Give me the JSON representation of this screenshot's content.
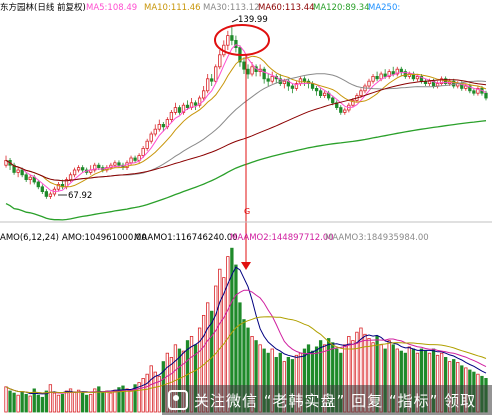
{
  "colors": {
    "up": "#d9262a",
    "down": "#1e8a2a",
    "ma5": "#ff4fd0",
    "ma10": "#c8960a",
    "ma30": "#8a8a8a",
    "ma60": "#8b0000",
    "ma120": "#2aa02a",
    "ma250": "#1e90ff",
    "circle": "#e01010",
    "vol_line1": "#000080",
    "vol_line2": "#d020a0",
    "vol_line3": "#b0a000"
  },
  "header": {
    "title": "东方园林(日线 前复权)",
    "ma5": "MA5:108.49",
    "ma10": "MA10:111.46",
    "ma30": "MA30:113.12",
    "ma60": "MA60:113.44",
    "ma120": "MA120:89.34",
    "ma250": "MA250:"
  },
  "annotations": {
    "high": "139.99",
    "low": "67.92",
    "marker": "G"
  },
  "volume_header": {
    "title": "AMO(6,12,24)",
    "amo": "AMO:104961000.00",
    "maamo1": "MAAMO1:116746240.00",
    "maamo2": "MAAMO2:144897712.00",
    "maamo3": "MAAMO3:184935984.00"
  },
  "watermark": "关注微信 “老韩实盘” 回复 “指标” 领取",
  "chart_data": {
    "type": "candlestick",
    "price_ylim": [
      60,
      145
    ],
    "volume_ylim": [
      0,
      400000000
    ],
    "x": [
      1,
      2,
      3,
      4,
      5,
      6,
      7,
      8,
      9,
      10,
      11,
      12,
      13,
      14,
      15,
      16,
      17,
      18,
      19,
      20,
      21,
      22,
      23,
      24,
      25,
      26,
      27,
      28,
      29,
      30,
      31,
      32,
      33,
      34,
      35,
      36,
      37,
      38,
      39,
      40,
      41,
      42,
      43,
      44,
      45,
      46,
      47,
      48,
      49,
      50,
      51,
      52,
      53,
      54,
      55,
      56,
      57,
      58,
      59,
      60,
      61,
      62,
      63,
      64,
      65,
      66,
      67,
      68,
      69,
      70,
      71,
      72,
      73,
      74,
      75,
      76,
      77,
      78,
      79,
      80,
      81,
      82,
      83,
      84,
      85,
      86,
      87,
      88,
      89,
      90,
      91,
      92,
      93,
      94,
      95,
      96,
      97,
      98,
      99,
      100,
      101,
      102,
      103,
      104,
      105,
      106,
      107,
      108,
      109,
      110,
      111,
      112,
      113,
      114,
      115,
      116,
      117,
      118,
      119,
      120
    ],
    "candles": [
      [
        1,
        82,
        84,
        81,
        86
      ],
      [
        2,
        84,
        82,
        80,
        85
      ],
      [
        3,
        82,
        79,
        78,
        83
      ],
      [
        4,
        79,
        80,
        77,
        81
      ],
      [
        5,
        80,
        78,
        77,
        81
      ],
      [
        6,
        78,
        76,
        75,
        79
      ],
      [
        7,
        76,
        77,
        74,
        78
      ],
      [
        8,
        77,
        75,
        74,
        78
      ],
      [
        9,
        75,
        73,
        72,
        76
      ],
      [
        10,
        73,
        71,
        70,
        74
      ],
      [
        11,
        71,
        69,
        68,
        72
      ],
      [
        12,
        69,
        70,
        67.92,
        71
      ],
      [
        13,
        70,
        72,
        69,
        73
      ],
      [
        14,
        72,
        74,
        71,
        75
      ],
      [
        15,
        74,
        73,
        72,
        76
      ],
      [
        16,
        73,
        76,
        72,
        77
      ],
      [
        17,
        76,
        78,
        75,
        79
      ],
      [
        18,
        78,
        80,
        77,
        81
      ],
      [
        19,
        80,
        81,
        79,
        82
      ],
      [
        20,
        81,
        80,
        79,
        82
      ],
      [
        21,
        80,
        79,
        78,
        81
      ],
      [
        22,
        79,
        80,
        78,
        82
      ],
      [
        23,
        80,
        82,
        79,
        83
      ],
      [
        24,
        82,
        81,
        80,
        83
      ],
      [
        25,
        81,
        80,
        79,
        82
      ],
      [
        26,
        80,
        81,
        79,
        82
      ],
      [
        27,
        81,
        82,
        80,
        83
      ],
      [
        28,
        82,
        83,
        81,
        84
      ],
      [
        29,
        83,
        82,
        81,
        84
      ],
      [
        30,
        82,
        81,
        80,
        83
      ],
      [
        31,
        81,
        83,
        80,
        84
      ],
      [
        32,
        83,
        85,
        82,
        86
      ],
      [
        33,
        85,
        84,
        83,
        86
      ],
      [
        34,
        84,
        86,
        83,
        87
      ],
      [
        35,
        86,
        89,
        85,
        90
      ],
      [
        36,
        89,
        92,
        88,
        93
      ],
      [
        37,
        92,
        95,
        91,
        96
      ],
      [
        38,
        95,
        97,
        94,
        99
      ],
      [
        39,
        97,
        99,
        96,
        101
      ],
      [
        40,
        99,
        98,
        96,
        100
      ],
      [
        41,
        98,
        101,
        97,
        102
      ],
      [
        42,
        101,
        104,
        100,
        105
      ],
      [
        43,
        104,
        106,
        103,
        108
      ],
      [
        44,
        106,
        104,
        103,
        107
      ],
      [
        45,
        104,
        107,
        103,
        108
      ],
      [
        46,
        107,
        106,
        105,
        109
      ],
      [
        47,
        106,
        108,
        105,
        110
      ],
      [
        48,
        108,
        107,
        105,
        109
      ],
      [
        49,
        107,
        110,
        106,
        111
      ],
      [
        50,
        110,
        113,
        109,
        115
      ],
      [
        51,
        113,
        118,
        112,
        120
      ],
      [
        52,
        118,
        117,
        115,
        120
      ],
      [
        53,
        117,
        123,
        116,
        124
      ],
      [
        54,
        123,
        128,
        122,
        130
      ],
      [
        55,
        128,
        132,
        127,
        134
      ],
      [
        56,
        132,
        136,
        130,
        138
      ],
      [
        57,
        136,
        134,
        132,
        139.99
      ],
      [
        58,
        134,
        131,
        129,
        136
      ],
      [
        59,
        131,
        125,
        123,
        132
      ],
      [
        60,
        125,
        122,
        120,
        127
      ],
      [
        61,
        122,
        120,
        118,
        124
      ],
      [
        62,
        120,
        123,
        119,
        125
      ],
      [
        63,
        123,
        121,
        119,
        124
      ],
      [
        64,
        121,
        122,
        119,
        124
      ],
      [
        65,
        122,
        118,
        116,
        123
      ],
      [
        66,
        118,
        117,
        115,
        120
      ],
      [
        67,
        117,
        119,
        116,
        121
      ],
      [
        68,
        119,
        118,
        116,
        120
      ],
      [
        69,
        118,
        116,
        115,
        120
      ],
      [
        70,
        116,
        117,
        114,
        118
      ],
      [
        71,
        117,
        115,
        113,
        118
      ],
      [
        72,
        115,
        114,
        112,
        116
      ],
      [
        73,
        114,
        116,
        113,
        117
      ],
      [
        74,
        116,
        118,
        115,
        119
      ],
      [
        75,
        118,
        117,
        115,
        119
      ],
      [
        76,
        117,
        116,
        114,
        118
      ],
      [
        77,
        116,
        114,
        113,
        117
      ],
      [
        78,
        114,
        113,
        111,
        115
      ],
      [
        79,
        113,
        111,
        110,
        114
      ],
      [
        80,
        111,
        112,
        110,
        113
      ],
      [
        81,
        112,
        110,
        109,
        113
      ],
      [
        82,
        110,
        108,
        107,
        111
      ],
      [
        83,
        108,
        106,
        105,
        109
      ],
      [
        84,
        106,
        104,
        103,
        107
      ],
      [
        85,
        104,
        105,
        103,
        106
      ],
      [
        86,
        105,
        107,
        104,
        108
      ],
      [
        87,
        107,
        109,
        106,
        110
      ],
      [
        88,
        109,
        111,
        108,
        112
      ],
      [
        89,
        111,
        113,
        110,
        114
      ],
      [
        90,
        113,
        115,
        112,
        116
      ],
      [
        91,
        115,
        117,
        114,
        118
      ],
      [
        92,
        117,
        119,
        116,
        120
      ],
      [
        93,
        119,
        118,
        117,
        121
      ],
      [
        94,
        118,
        120,
        117,
        121
      ],
      [
        95,
        120,
        119,
        118,
        122
      ],
      [
        96,
        119,
        121,
        118,
        122
      ],
      [
        97,
        121,
        120,
        119,
        123
      ],
      [
        98,
        120,
        122,
        119,
        123
      ],
      [
        99,
        122,
        121,
        119,
        123
      ],
      [
        100,
        121,
        119,
        118,
        122
      ],
      [
        101,
        119,
        120,
        118,
        121
      ],
      [
        102,
        120,
        118,
        117,
        121
      ],
      [
        103,
        118,
        119,
        117,
        120
      ],
      [
        104,
        119,
        117,
        116,
        120
      ],
      [
        105,
        117,
        116,
        115,
        118
      ],
      [
        106,
        116,
        117,
        115,
        118
      ],
      [
        107,
        117,
        115,
        114,
        118
      ],
      [
        108,
        115,
        116,
        114,
        117
      ],
      [
        109,
        116,
        118,
        115,
        119
      ],
      [
        110,
        118,
        116,
        115,
        119
      ],
      [
        111,
        116,
        117,
        115,
        118
      ],
      [
        112,
        117,
        115,
        114,
        118
      ],
      [
        113,
        115,
        116,
        114,
        117
      ],
      [
        114,
        116,
        114,
        113,
        117
      ],
      [
        115,
        114,
        115,
        113,
        116
      ],
      [
        116,
        115,
        113,
        112,
        116
      ],
      [
        117,
        113,
        112,
        111,
        114
      ],
      [
        118,
        112,
        114,
        111,
        115
      ],
      [
        119,
        114,
        112,
        111,
        115
      ],
      [
        120,
        112,
        110,
        109,
        113
      ]
    ],
    "volume": [
      60,
      50,
      45,
      40,
      48,
      42,
      38,
      55,
      40,
      35,
      50,
      65,
      45,
      40,
      42,
      50,
      55,
      48,
      52,
      45,
      40,
      42,
      55,
      60,
      48,
      50,
      45,
      52,
      58,
      62,
      55,
      50,
      65,
      70,
      80,
      90,
      110,
      95,
      85,
      120,
      140,
      130,
      160,
      150,
      145,
      170,
      180,
      160,
      200,
      230,
      260,
      240,
      300,
      340,
      320,
      370,
      390,
      350,
      260,
      220,
      200,
      180,
      170,
      160,
      150,
      140,
      150,
      130,
      140,
      120,
      130,
      125,
      135,
      140,
      150,
      160,
      145,
      155,
      170,
      160,
      175,
      165,
      150,
      140,
      160,
      180,
      170,
      190,
      200,
      185,
      175,
      165,
      180,
      160,
      150,
      170,
      160,
      150,
      145,
      140,
      155,
      150,
      140,
      150,
      145,
      140,
      150,
      135,
      140,
      130,
      120,
      125,
      118,
      110,
      105,
      100,
      95,
      90,
      85,
      80
    ]
  }
}
